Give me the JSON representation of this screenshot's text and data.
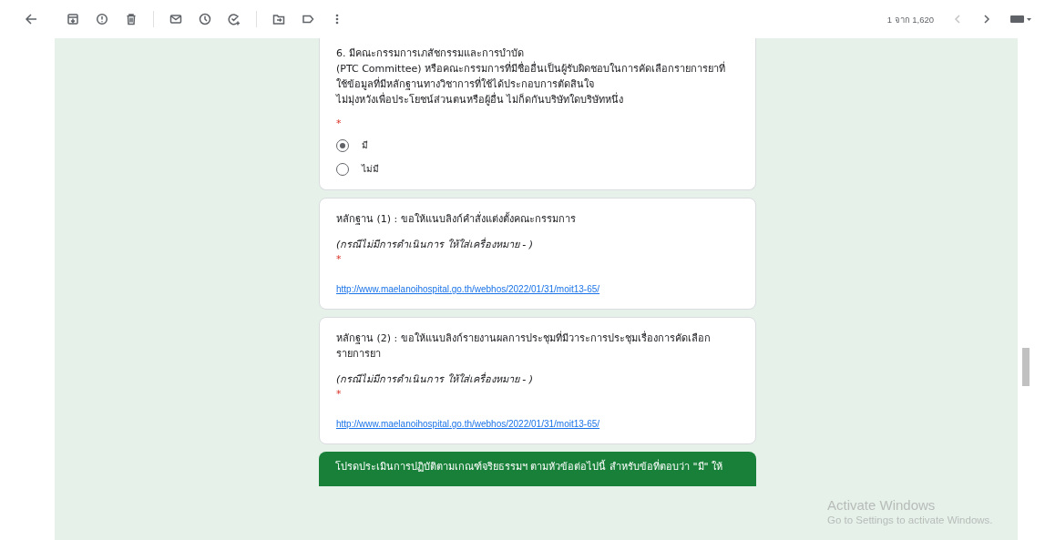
{
  "toolbar": {
    "pager": "1 จาก 1,620"
  },
  "questions": [
    {
      "kind": "radio",
      "title_lines": [
        "6. มีคณะกรรมการเภสัชกรรมและการบำบัด",
        "(PTC Committee) หรือคณะกรรมการที่มีชื่ออื่นเป็นผู้รับผิดชอบในการคัดเลือกรายการยาที่",
        "ใช้ข้อมูลที่มีหลักฐานทางวิชาการที่ใช้ได้ประกอบการตัดสินใจ",
        "ไม่มุ่งหวังเพื่อประโยชน์ส่วนตนหรือผู้อื่น ไม่ก็ดกันบริษัทใดบริษัทหนึ่ง"
      ],
      "required_mark": "*",
      "options": [
        {
          "label": "มี",
          "selected": true
        },
        {
          "label": "ไม่มี",
          "selected": false
        }
      ]
    },
    {
      "kind": "link",
      "title_lines": [
        "หลักฐาน (1) : ขอให้แนบลิงก์คำสั่งแต่งตั้งคณะกรรมการ"
      ],
      "note": "(กรณีไม่มีการดำเนินการ ให้ใส่เครื่องหมาย - )",
      "required_mark": "*",
      "answer": "http://www.maelanoihospital.go.th/webhos/2022/01/31/moit13-65/"
    },
    {
      "kind": "link",
      "title_lines": [
        "หลักฐาน (2) : ขอให้แนบลิงก์รายงานผลการประชุมที่มีวาระการประชุมเรื่องการคัดเลือก",
        "รายการยา"
      ],
      "note": "(กรณีไม่มีการดำเนินการ ให้ใส่เครื่องหมาย - )",
      "required_mark": "*",
      "answer": "http://www.maelanoihospital.go.th/webhos/2022/01/31/moit13-65/"
    }
  ],
  "section_banner": "โปรดประเมินการปฏิบัติตามเกณฑ์จริยธรรมฯ ตามหัวข้อต่อไปนี้ สำหรับข้อที่ตอบว่า \"มี\" ให้",
  "activation_notice": {
    "title": "Activate Windows",
    "subtitle": "Go to Settings to activate Windows."
  }
}
